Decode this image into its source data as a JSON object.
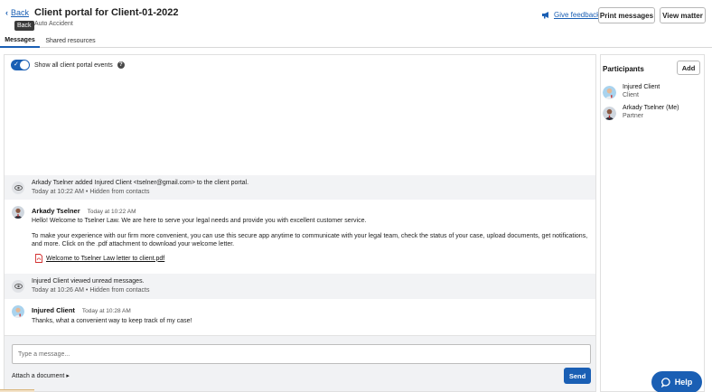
{
  "header": {
    "back_label": "Back",
    "back_tooltip": "Back",
    "title": "Client portal for Client-01-2022",
    "subtitle": "Auto Accident",
    "feedback_label": "Give feedback",
    "print_label": "Print messages",
    "view_matter_label": "View matter"
  },
  "tabs": [
    {
      "label": "Messages",
      "active": true
    },
    {
      "label": "Shared resources",
      "active": false
    }
  ],
  "toggle": {
    "label": "Show all client portal events",
    "on": true
  },
  "feed": {
    "event1": {
      "text": "Arkady Tselner added Injured Client <tselner@gmail.com> to the client portal.",
      "meta": "Today at 10:22 AM • Hidden from contacts"
    },
    "message1": {
      "author": "Arkady Tselner",
      "time": "Today at 10:22 AM",
      "line1": "Hello! Welcome to Tselner Law. We are here to serve your legal needs and provide you with excellent customer service.",
      "line2": "To make your experience with our firm more convenient, you can use this secure app anytime to communicate with your legal team, check the status of your case, upload documents, get notifications,",
      "line3": "and more. Click on the .pdf attachment to download your welcome letter.",
      "attachment": "Welcome to Tselner Law letter to client.pdf"
    },
    "event2": {
      "text": "Injured Client viewed unread messages.",
      "meta": "Today at 10:26 AM • Hidden from contacts"
    },
    "message2": {
      "author": "Injured Client",
      "time": "Today at 10:28 AM",
      "line1": "Thanks, what a convenient way to keep track of my case!"
    }
  },
  "composer": {
    "placeholder": "Type a message...",
    "attach_label": "Attach a document ▸",
    "send_label": "Send"
  },
  "participants": {
    "title": "Participants",
    "add_label": "Add",
    "items": [
      {
        "name": "Injured Client",
        "role": "Client"
      },
      {
        "name": "Arkady Tselner (Me)",
        "role": "Partner"
      }
    ]
  },
  "help_label": "Help",
  "colors": {
    "accent": "#1a5fb4",
    "event_bg": "#f2f3f5",
    "pdf_red": "#d32f2f"
  }
}
